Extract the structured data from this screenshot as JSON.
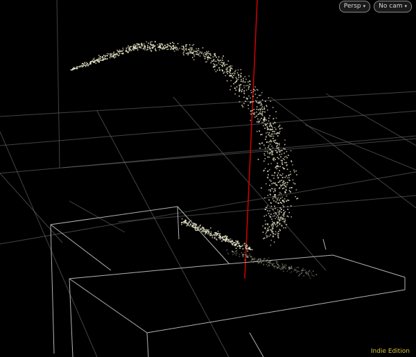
{
  "viewport": {
    "camera_view_label": "Persp",
    "camera_select_label": "No cam",
    "dropdown_icon": "chevron-down-icon",
    "edition_label": "Indie Edition"
  },
  "colors": {
    "background": "#000000",
    "grid": "#7a7a7a",
    "box": "#b4b4b4",
    "particle": "#e8e6c8",
    "axis": "#d40000",
    "edition_text": "#d6c43a"
  }
}
